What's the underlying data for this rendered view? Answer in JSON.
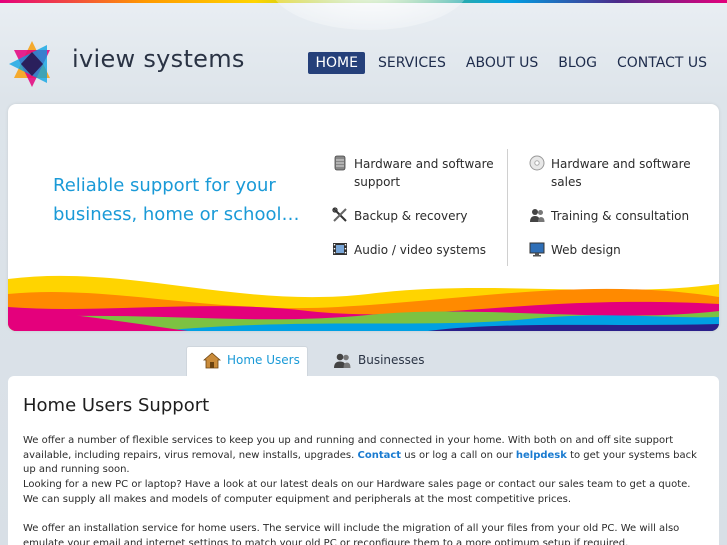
{
  "header": {
    "brand": "iview systems",
    "nav": [
      {
        "label": "HOME",
        "active": true
      },
      {
        "label": "SERVICES",
        "active": false
      },
      {
        "label": "ABOUT US",
        "active": false
      },
      {
        "label": "BLOG",
        "active": false
      },
      {
        "label": "CONTACT US",
        "active": false
      }
    ]
  },
  "hero": {
    "tagline_line1": "Reliable support for your",
    "tagline_line2": "business, home or school…",
    "services": [
      {
        "label_line1": "Hardware and software",
        "label_line2": "support",
        "icon": "server-icon"
      },
      {
        "label_line1": "Backup & recovery",
        "label_line2": "",
        "icon": "tools-icon"
      },
      {
        "label_line1": "Audio / video systems",
        "label_line2": "",
        "icon": "film-icon"
      },
      {
        "label_line1": "Hardware and software",
        "label_line2": "sales",
        "icon": "disc-icon"
      },
      {
        "label_line1": "Training & consultation",
        "label_line2": "",
        "icon": "people-icon"
      },
      {
        "label_line1": "Web design",
        "label_line2": "",
        "icon": "monitor-icon"
      }
    ]
  },
  "tabs": [
    {
      "label": "Home Users",
      "active": true,
      "icon": "house-icon"
    },
    {
      "label": "Businesses",
      "active": false,
      "icon": "users-icon"
    }
  ],
  "content": {
    "title": "Home Users Support",
    "p1_a": "We offer a number of flexible services to keep you up and running and connected in your home. With both on and off site support available, including repairs, virus removal, new installs, upgrades. ",
    "p1_link1": "Contact",
    "p1_b": " us or log a call on our ",
    "p1_link2": "helpdesk",
    "p1_c": " to get your systems back up and running soon.",
    "p2": "Looking for a new PC or laptop? Have a look at our latest deals on our Hardware sales page or contact our sales team to get a quote. We can supply all makes and models of computer equipment and peripherals at the most competitive prices.",
    "p3": "We offer an installation service for home users. The service will include the migration of all your files from your old PC. We will also emulate your email and internet settings to match your old PC or reconfigure them to a more optimum setup if required."
  },
  "colors": {
    "accent": "#1a9ad7",
    "nav_active": "#25407a",
    "link": "#1a7bd0"
  }
}
